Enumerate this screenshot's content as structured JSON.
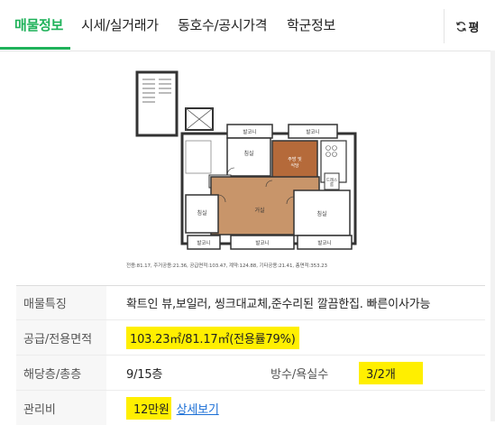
{
  "tabs": [
    {
      "label": "매물정보",
      "active": true
    },
    {
      "label": "시세/실거래가",
      "active": false
    },
    {
      "label": "동호수/공시가격",
      "active": false
    },
    {
      "label": "학군정보",
      "active": false
    }
  ],
  "refresh": {
    "icon": "refresh-icon",
    "label": "평"
  },
  "floorplan": {
    "rooms": {
      "balcony_top_left": "발코니",
      "balcony_top_right": "발코니",
      "room_top": "침실",
      "kitchen": "주방 및\n식당",
      "living": "거실",
      "room_left": "침실",
      "room_right": "침실",
      "balcony_bottom_left": "발코니",
      "balcony_bottom_mid": "발코니",
      "balcony_bottom_right": "발코니",
      "dress": "드레스\n룸"
    },
    "caption": "전용:81.17, 주거공용:21.36, 공급면적:103.47, 계약:124.88, 기타공용:21.41, 총면적:353.23"
  },
  "info": {
    "features_label": "매물특징",
    "features_value": "확트인 뷰,보일러, 씽크대교체,준수리된 깔끔한집. 빠른이사가능",
    "area_label": "공급/전용면적",
    "area_value": "103.23㎡/81.17㎡(전용률79%)",
    "floor_label": "해당층/총층",
    "floor_value": "9/15층",
    "rooms_label": "방수/욕실수",
    "rooms_value": "3/2개",
    "fee_label": "관리비",
    "fee_value": "12만원",
    "fee_link": "상세보기"
  },
  "colors": {
    "accent": "#1fb25a",
    "highlight": "#ffef00",
    "link": "#1b6fd6",
    "living": "#c8956a"
  }
}
